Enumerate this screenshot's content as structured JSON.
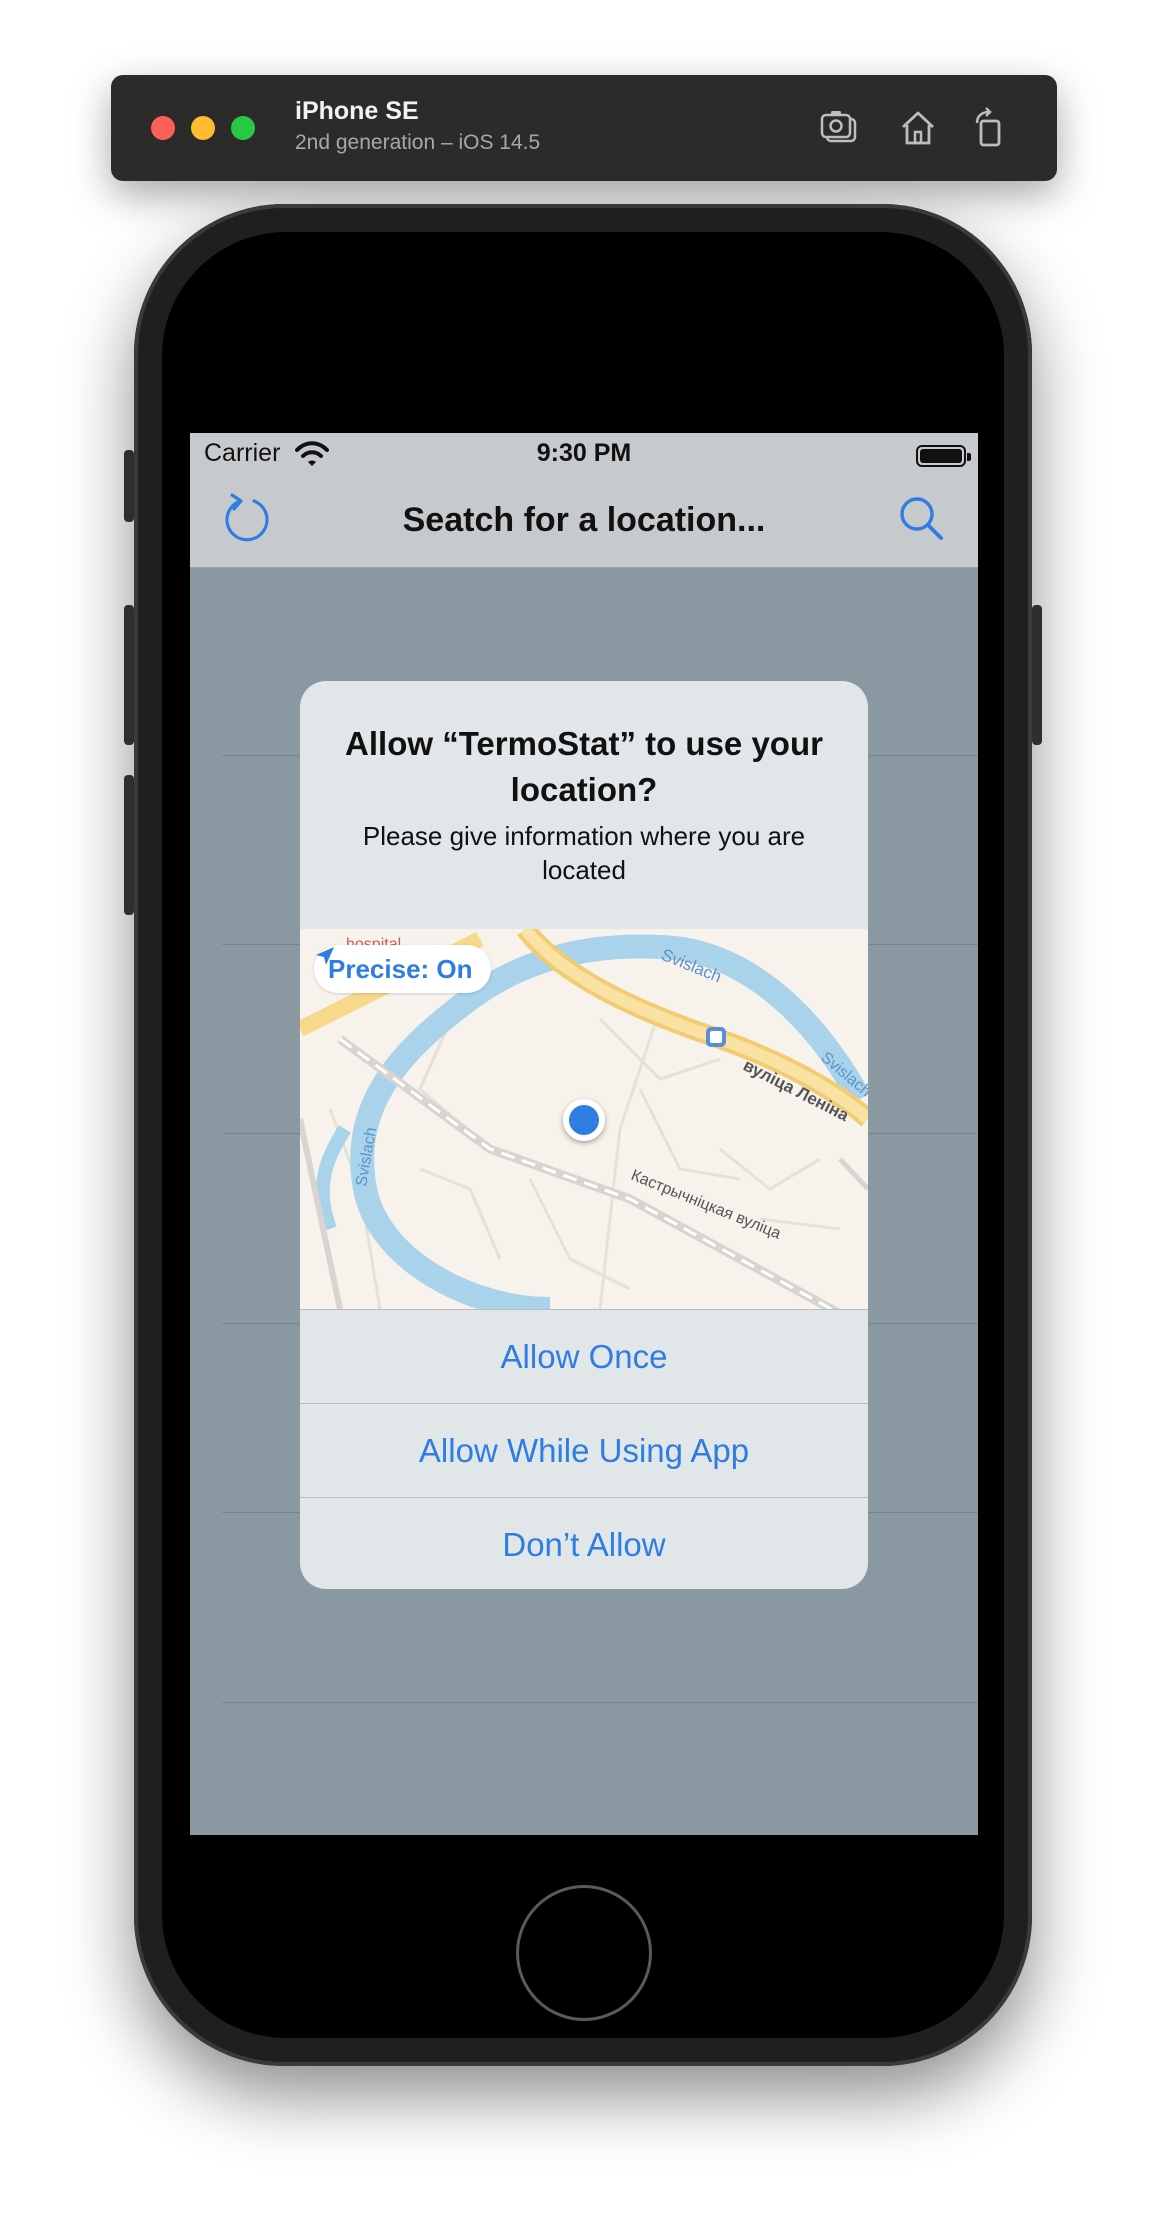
{
  "simulator": {
    "device_name": "iPhone SE",
    "device_subtitle": "2nd generation – iOS 14.5",
    "icons": [
      "camera-icon",
      "home-icon",
      "rotate-icon"
    ]
  },
  "status_bar": {
    "carrier": "Carrier",
    "time": "9:30 PM"
  },
  "nav_bar": {
    "title": "Seatch for a location...",
    "left_icon": "refresh-icon",
    "right_icon": "search-icon"
  },
  "alert": {
    "title": "Allow “TermoStat” to use your location?",
    "message": "Please give information where you are located",
    "precise_label": "Precise: On",
    "buttons": {
      "allow_once": "Allow Once",
      "allow_while_using": "Allow While Using App",
      "dont_allow": "Don’t Allow"
    },
    "map_labels": {
      "river_1": "Svislach",
      "river_2": "Svislach",
      "river_3": "Svislach",
      "street_1": "вуліца Леніна",
      "street_2": "Кастрычніцкая вуліца",
      "poi": "hospital"
    }
  },
  "colors": {
    "accent": "#2f7de1",
    "screen_dim": "#8a98a2",
    "alert_bg": "#e1e6e9"
  }
}
